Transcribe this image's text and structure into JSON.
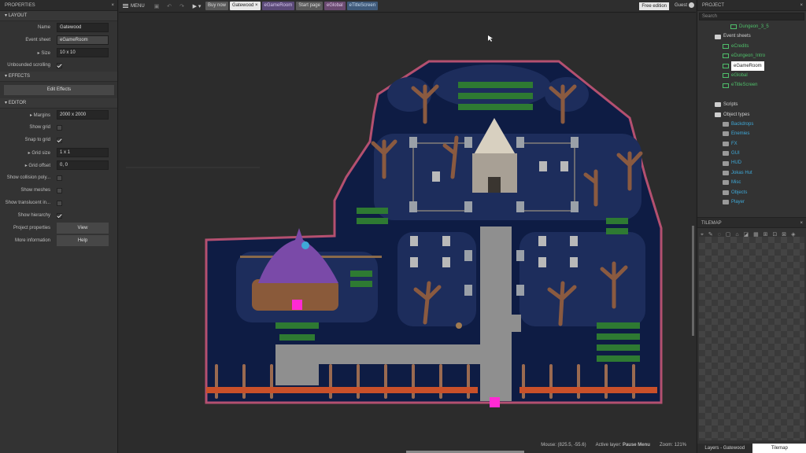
{
  "properties": {
    "title": "PROPERTIES",
    "layout_section": "LAYOUT",
    "name_label": "Name",
    "name_value": "Gatewood",
    "event_sheet_label": "Event sheet",
    "event_sheet_value": "eGameRoom",
    "size_label": "Size",
    "size_value": "10 x 10",
    "unbounded_label": "Unbounded scrolling",
    "effects_section": "EFFECTS",
    "edit_effects": "Edit Effects",
    "editor_section": "EDITOR",
    "margins_label": "Margins",
    "margins_value": "2000 x 2000",
    "show_grid_label": "Show grid",
    "snap_label": "Snap to grid",
    "grid_size_label": "Grid size",
    "grid_size_value": "1 x 1",
    "grid_offset_label": "Grid offset",
    "grid_offset_value": "0, 0",
    "collision_label": "Show collision poly...",
    "meshes_label": "Show meshes",
    "translucent_label": "Show translucent in...",
    "hierarchy_label": "Show hierarchy",
    "project_props_label": "Project properties",
    "view_btn": "View",
    "more_info_label": "More information",
    "help_btn": "Help"
  },
  "topbar": {
    "menu": "MENU",
    "tabs": [
      {
        "label": "Buy now",
        "bg": "#5a5a5a",
        "fg": "#dddddd"
      },
      {
        "label": "Gatewood",
        "bg": "#e8e8e8",
        "fg": "#222222"
      },
      {
        "label": "eGameRoom",
        "bg": "#5b4a78",
        "fg": "#d8c8f0"
      },
      {
        "label": "Start page",
        "bg": "#5a5a5a",
        "fg": "#dddddd"
      },
      {
        "label": "eGlobal",
        "bg": "#6a4a70",
        "fg": "#e0c8e8"
      },
      {
        "label": "eTitleScreen",
        "bg": "#3f5a7a",
        "fg": "#c8dcf0"
      }
    ],
    "close_glyph": "×",
    "free_edition": "Free edition",
    "guest": "Guest"
  },
  "status": {
    "mouse": "Mouse: (825.5, -55.6)",
    "active_layer_label": "Active layer:",
    "active_layer_value": "Pause Menu",
    "zoom": "Zoom: 121%"
  },
  "project": {
    "title": "PROJECT",
    "search_placeholder": "Search",
    "items": [
      {
        "label": "Dungeon_3_5",
        "kind": "esheet",
        "indent": 42
      },
      {
        "label": "Event sheets",
        "kind": "folder",
        "indent": 22
      },
      {
        "label": "eCredits",
        "kind": "esheet",
        "indent": 32
      },
      {
        "label": "eDungeon_Intro",
        "kind": "esheet",
        "indent": 32
      },
      {
        "label": "eGameRoom",
        "kind": "esheet-sel",
        "indent": 32
      },
      {
        "label": "eGlobal",
        "kind": "esheet",
        "indent": 32
      },
      {
        "label": "eTitleScreen",
        "kind": "esheet",
        "indent": 32
      },
      {
        "label": "",
        "kind": "gap",
        "indent": 0
      },
      {
        "label": "Scripts",
        "kind": "folder",
        "indent": 22
      },
      {
        "label": "Object types",
        "kind": "folder",
        "indent": 22
      },
      {
        "label": "Backdrops",
        "kind": "obj",
        "indent": 32
      },
      {
        "label": "Enemies",
        "kind": "obj",
        "indent": 32
      },
      {
        "label": "FX",
        "kind": "obj",
        "indent": 32
      },
      {
        "label": "GUI",
        "kind": "obj",
        "indent": 32
      },
      {
        "label": "HUD",
        "kind": "obj",
        "indent": 32
      },
      {
        "label": "Jokas Hut",
        "kind": "obj",
        "indent": 32
      },
      {
        "label": "Misc",
        "kind": "obj",
        "indent": 32
      },
      {
        "label": "Objects",
        "kind": "obj",
        "indent": 32
      },
      {
        "label": "Player",
        "kind": "obj",
        "indent": 32
      }
    ]
  },
  "tilemap": {
    "title": "TILEMAP",
    "tools_row1": "⌖ ✎ ◌ ▢ ⌂ ◪ ▦ ⊞ ⊡ ⊠ ◈ ⊘ ◩",
    "tools_row2": "⟲ ⟳ ✕ ⊕ ⊖ ⊙ ▣ ▤"
  },
  "bottom_tabs": [
    {
      "label": "Layers - Gatewood",
      "active": false
    },
    {
      "label": "Tilemap",
      "active": true
    }
  ],
  "colors": {
    "accent_green": "#4fbf6a",
    "object_blue": "#3fa9d8",
    "map_water": "#1d2d5c",
    "map_deep": "#0e1c44",
    "marker": "#ff2ad4"
  }
}
